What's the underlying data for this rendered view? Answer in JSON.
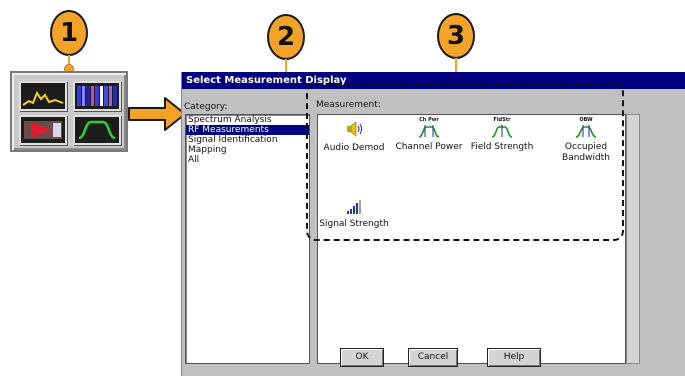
{
  "callouts": [
    "1",
    "2",
    "3"
  ],
  "icon_panel": {
    "icons": [
      "spectrum-trace-icon",
      "spectrogram-icon",
      "mapping-icon",
      "rf-measurement-icon"
    ]
  },
  "dialog": {
    "title": "Select Measurement Display",
    "category_label": "Category:",
    "categories": [
      "Spectrum Analysis",
      "RF Measurements",
      "Signal Identification",
      "Mapping",
      "All"
    ],
    "selected_category": "RF Measurements",
    "measurement_label": "Measurement:",
    "measurements": [
      {
        "icon_text": "",
        "label": "Audio Demod"
      },
      {
        "icon_text": "Ch Pwr",
        "label": "Channel Power"
      },
      {
        "icon_text": "FldStr",
        "label": "Field Strength"
      },
      {
        "icon_text": "OBW",
        "label": "Occupied Bandwidth"
      },
      {
        "icon_text": "",
        "label": "Signal Strength"
      }
    ],
    "buttons": {
      "ok": "OK",
      "cancel": "Cancel",
      "help": "Help"
    }
  },
  "colors": {
    "callout": "#f4a328",
    "titlebar": "#000080",
    "selection": "#000080",
    "dialog_bg": "#c0c0c0"
  }
}
